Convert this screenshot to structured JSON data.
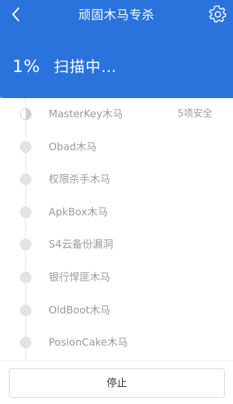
{
  "header": {
    "title": "顽固木马专杀",
    "percent": "1%",
    "status": "扫描中…",
    "progress_fraction": 0.01
  },
  "icons": {
    "back": "chevron-left-icon",
    "settings": "gear-icon"
  },
  "colors": {
    "header_bg": "#2a73dc",
    "progress": "#2ad15a",
    "item_text": "#9a9a9a"
  },
  "scan_items": [
    {
      "name": "MasterKey木马",
      "result": "5项安全",
      "state": "scanning"
    },
    {
      "name": "Obad木马",
      "result": "",
      "state": "pending"
    },
    {
      "name": "权限杀手木马",
      "result": "",
      "state": "pending"
    },
    {
      "name": "ApkBox木马",
      "result": "",
      "state": "pending"
    },
    {
      "name": "S4云备份漏洞",
      "result": "",
      "state": "pending"
    },
    {
      "name": "银行悍匪木马",
      "result": "",
      "state": "pending"
    },
    {
      "name": "OldBoot木马",
      "result": "",
      "state": "pending"
    },
    {
      "name": "PosionCake木马",
      "result": "",
      "state": "pending"
    }
  ],
  "footer": {
    "stop_label": "停止"
  }
}
